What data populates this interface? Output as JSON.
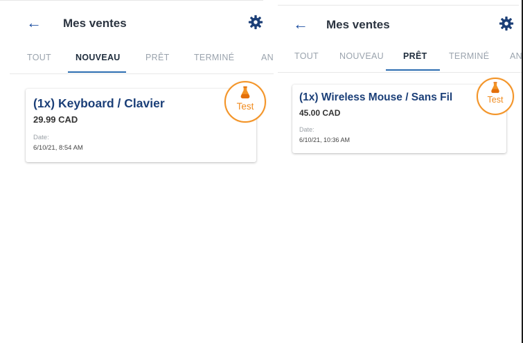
{
  "left_screen": {
    "header": {
      "title": "Mes ventes"
    },
    "tabs": [
      {
        "label": "TOUT",
        "active": false
      },
      {
        "label": "NOUVEAU",
        "active": true
      },
      {
        "label": "PRÊT",
        "active": false
      },
      {
        "label": "TERMINÉ",
        "active": false
      },
      {
        "label": "AN",
        "active": false
      }
    ],
    "card": {
      "title": "(1x) Keyboard / Clavier",
      "price": "29.99 CAD",
      "date_label": "Date:",
      "date": "6/10/21, 8:54 AM",
      "badge_label": "Test"
    }
  },
  "right_screen": {
    "header": {
      "title": "Mes ventes"
    },
    "tabs": [
      {
        "label": "TOUT",
        "active": false
      },
      {
        "label": "NOUVEAU",
        "active": false
      },
      {
        "label": "PRÊT",
        "active": true
      },
      {
        "label": "TERMINÉ",
        "active": false
      },
      {
        "label": "AN",
        "active": false
      }
    ],
    "card": {
      "title": "(1x) Wireless Mouse / Sans Fil",
      "price": "45.00 CAD",
      "date_label": "Date:",
      "date": "6/10/21, 10:36 AM",
      "badge_label": "Test"
    }
  },
  "colors": {
    "accent": "#2b6cb0",
    "title_blue": "#1b3f78",
    "badge_orange": "#f39325"
  },
  "icons": [
    "back-arrow-icon",
    "gear-icon",
    "flask-icon"
  ]
}
